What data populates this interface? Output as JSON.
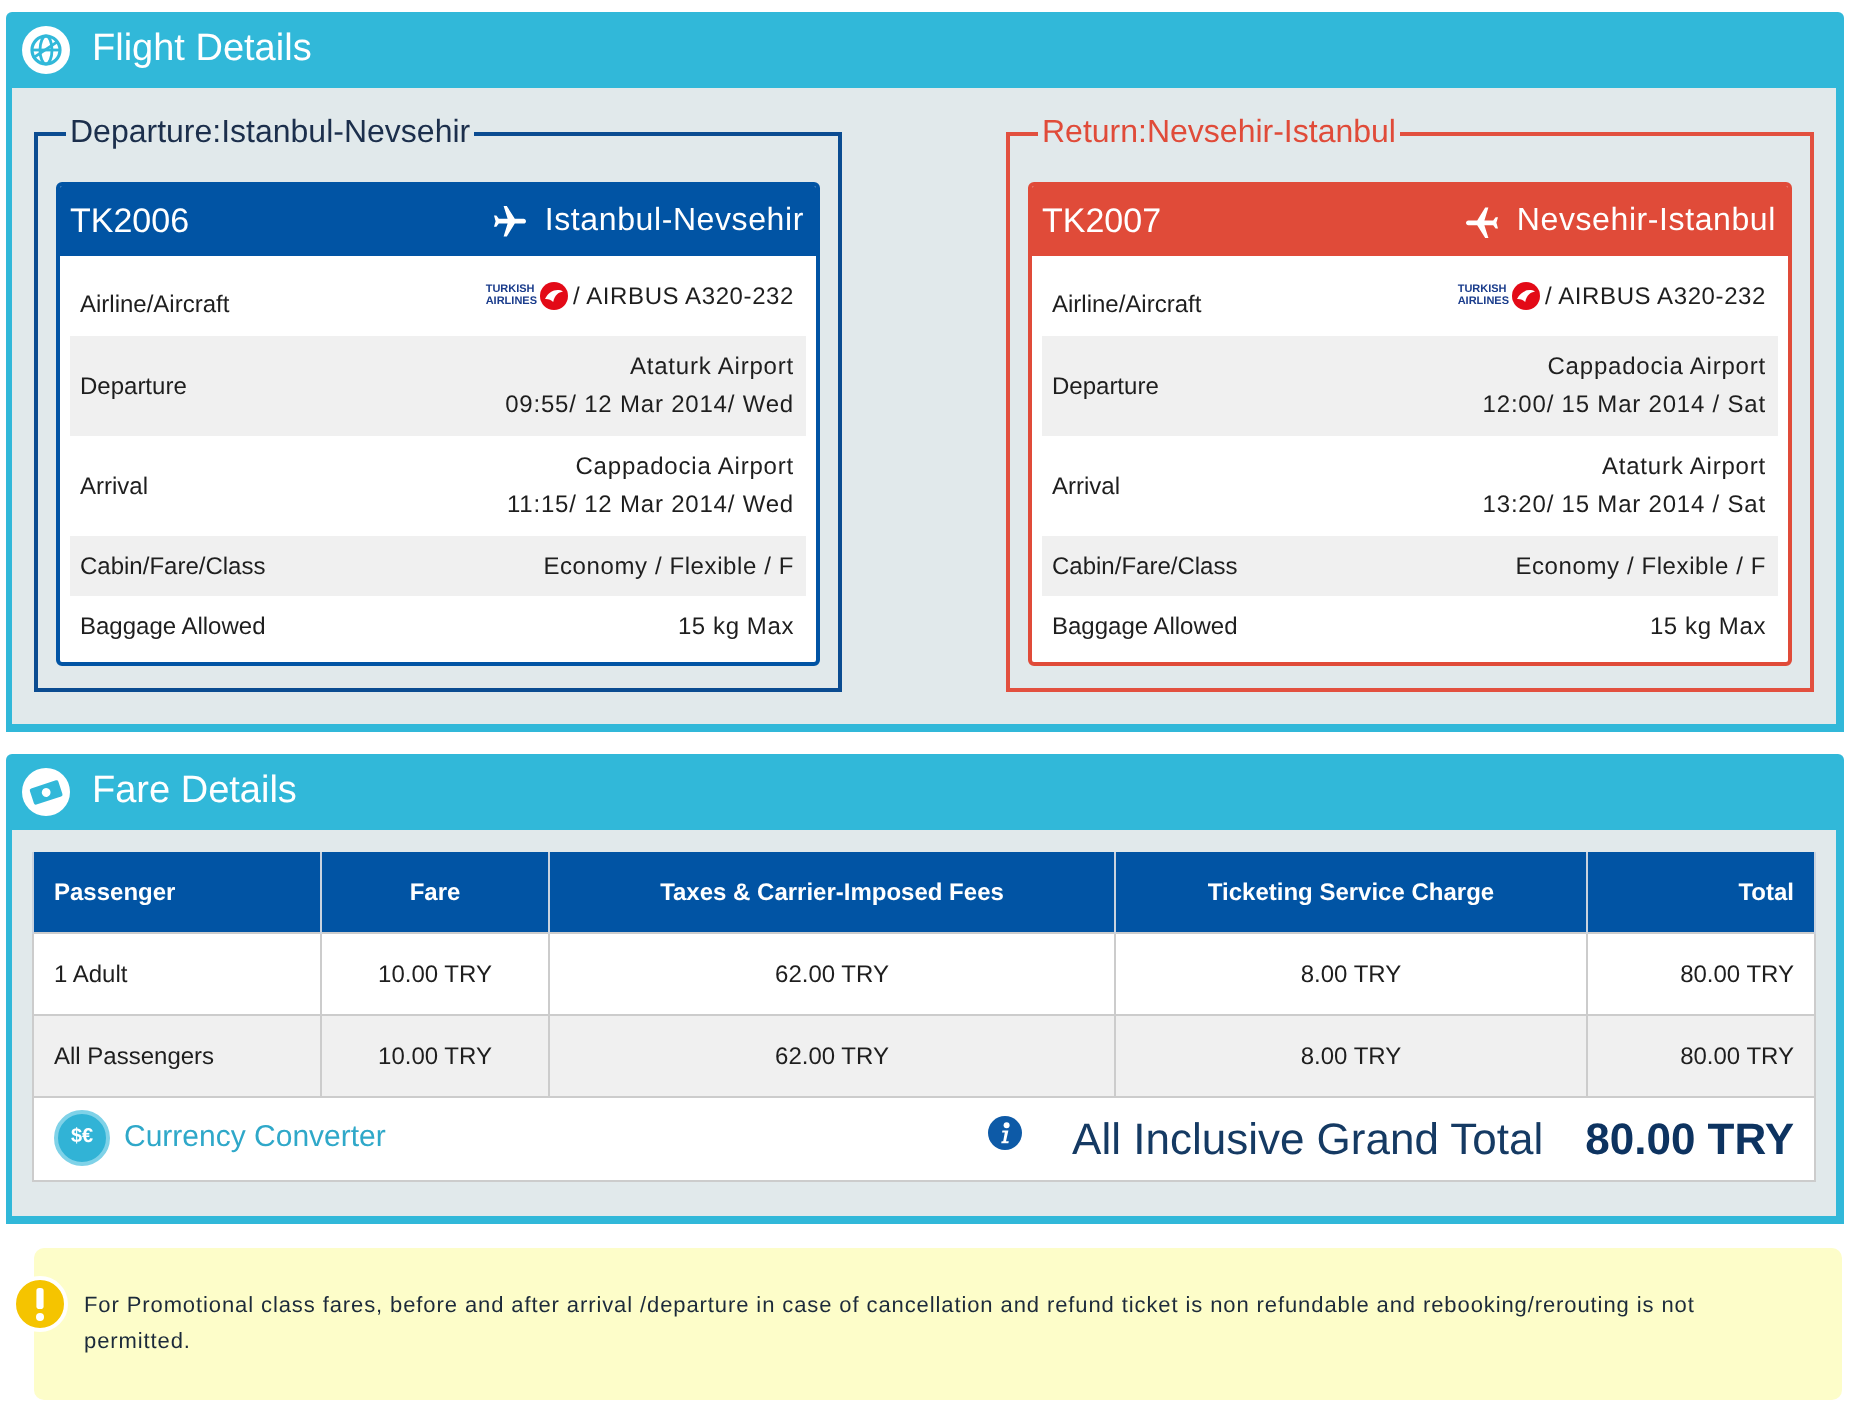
{
  "flight_details": {
    "title": "Flight Details",
    "legs": [
      {
        "kind": "departure",
        "legend": "Departure:Istanbul-Nevsehir",
        "flight_number": "TK2006",
        "route": "Istanbul-Nevsehir",
        "rows": [
          {
            "kind": "airline",
            "label": "Airline/Aircraft",
            "logo_lines": [
              "TURKISH",
              "AIRLINES"
            ],
            "value": "/ AIRBUS A320-232"
          },
          {
            "kind": "schedule",
            "label": "Departure",
            "lines": [
              "Ataturk Airport",
              "09:55/ 12 Mar 2014/ Wed"
            ]
          },
          {
            "kind": "schedule",
            "label": "Arrival",
            "lines": [
              "Cappadocia Airport",
              "11:15/ 12 Mar 2014/ Wed"
            ]
          },
          {
            "kind": "text",
            "label": "Cabin/Fare/Class",
            "value": "Economy / Flexible / F"
          },
          {
            "kind": "text",
            "label": "Baggage Allowed",
            "value": "15 kg Max"
          }
        ]
      },
      {
        "kind": "return",
        "legend": "Return:Nevsehir-Istanbul",
        "flight_number": "TK2007",
        "route": "Nevsehir-Istanbul",
        "rows": [
          {
            "kind": "airline",
            "label": "Airline/Aircraft",
            "logo_lines": [
              "TURKISH",
              "AIRLINES"
            ],
            "value": "/ AIRBUS A320-232"
          },
          {
            "kind": "schedule",
            "label": "Departure",
            "lines": [
              "Cappadocia Airport",
              "12:00/ 15 Mar 2014 / Sat"
            ]
          },
          {
            "kind": "schedule",
            "label": "Arrival",
            "lines": [
              "Ataturk Airport",
              "13:20/ 15 Mar 2014 / Sat"
            ]
          },
          {
            "kind": "text",
            "label": "Cabin/Fare/Class",
            "value": "Economy / Flexible / F"
          },
          {
            "kind": "text",
            "label": "Baggage Allowed",
            "value": "15 kg Max"
          }
        ]
      }
    ]
  },
  "fare_details": {
    "title": "Fare Details",
    "table": {
      "columns": [
        "Passenger",
        "Fare",
        "Taxes & Carrier-Imposed Fees",
        "Ticketing Service Charge",
        "Total"
      ],
      "rows": [
        [
          "1 Adult",
          "10.00 TRY",
          "62.00 TRY",
          "8.00 TRY",
          "80.00 TRY"
        ],
        [
          "All Passengers",
          "10.00 TRY",
          "62.00 TRY",
          "8.00 TRY",
          "80.00 TRY"
        ]
      ]
    },
    "currency_converter": {
      "icon_glyphs": "$€",
      "label": "Currency Converter"
    },
    "grand_total": {
      "label": "All Inclusive Grand Total",
      "value": "80.00 TRY"
    }
  },
  "notice": {
    "text": "For Promotional class fares, before and after arrival /departure in case of cancellation and refund ticket is non refundable and rebooking/rerouting is not permitted."
  }
}
